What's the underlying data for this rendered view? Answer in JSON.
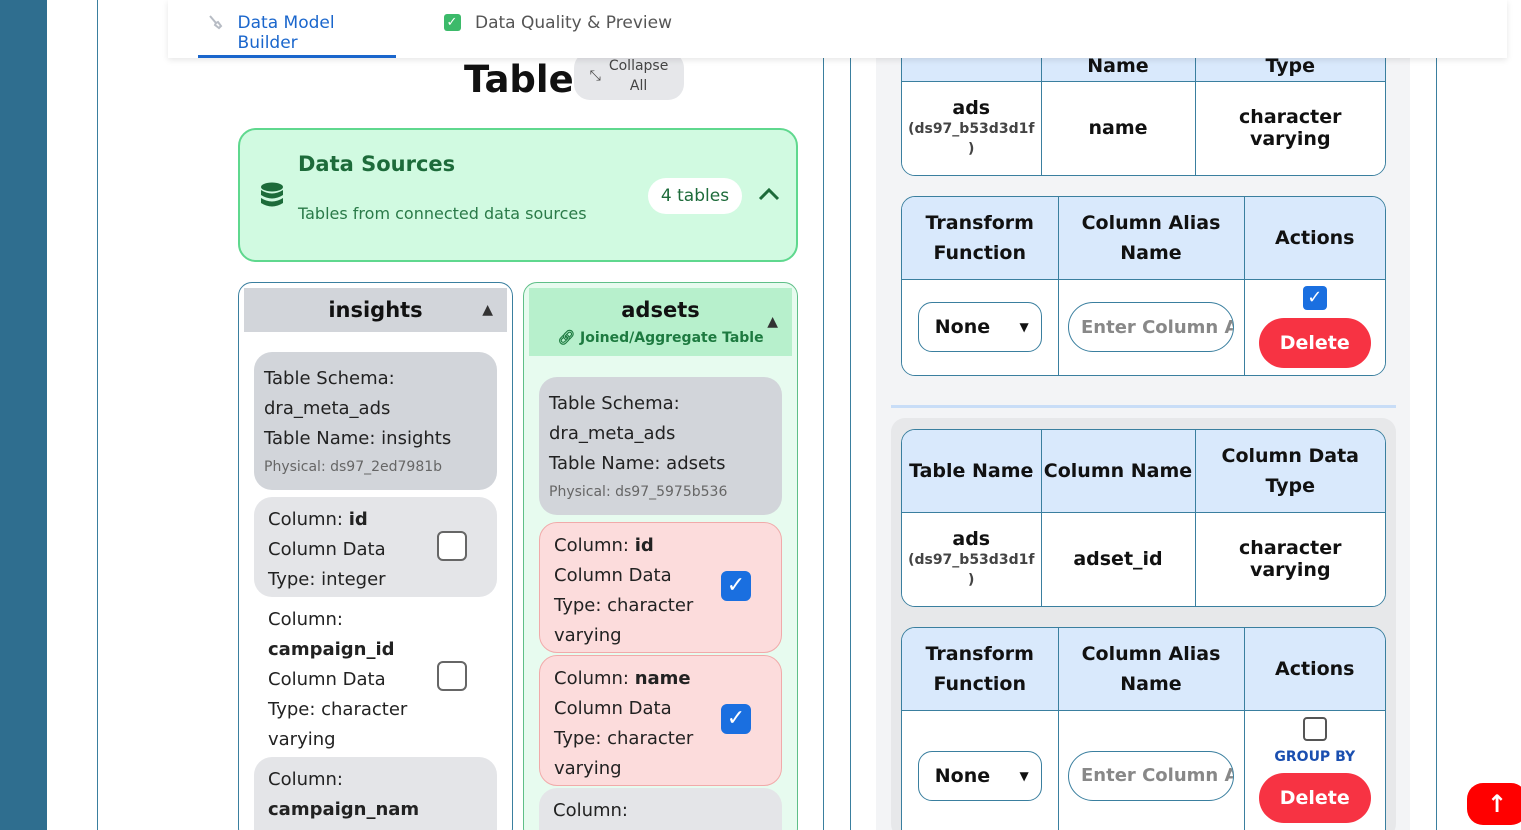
{
  "tabs": [
    {
      "label": "Data Model Builder",
      "icon": "wrench-icon"
    },
    {
      "label": "Data Quality & Preview",
      "icon": "checkbox-icon"
    }
  ],
  "tables_panel": {
    "title": "Tables",
    "collapse_label_line1": "Collapse",
    "collapse_label_line2": "All"
  },
  "data_sources": {
    "title": "Data Sources",
    "subtitle": "Tables from connected data sources",
    "count": "4 tables"
  },
  "insights": {
    "name": "insights",
    "schema_line1": "Table Schema:",
    "schema_line2": "dra_meta_ads",
    "table_name_line": "Table Name: insights",
    "physical": "Physical: ds97_2ed7981b",
    "columns": [
      {
        "prefix": "Column: ",
        "name": "id",
        "type_line1": "Column Data",
        "type_line2": "Type: integer",
        "checked": false
      },
      {
        "prefix": "Column:",
        "name": "campaign_id",
        "type_line1": "Column Data",
        "type_line2": "Type: character",
        "type_line3": "varying",
        "checked": false
      },
      {
        "prefix": "Column:",
        "name": "campaign_nam"
      }
    ]
  },
  "adsets": {
    "name": "adsets",
    "joined_label": "Joined/Aggregate Table",
    "schema_line1": "Table Schema:",
    "schema_line2": "dra_meta_ads",
    "table_name_line": "Table Name: adsets",
    "physical": "Physical: ds97_5975b536",
    "columns": [
      {
        "prefix": "Column: ",
        "name": "id",
        "type_line1": "Column Data",
        "type_line2": "Type: character",
        "type_line3": "varying",
        "checked": true
      },
      {
        "prefix": "Column: ",
        "name": "name",
        "type_line1": "Column Data",
        "type_line2": "Type: character",
        "type_line3": "varying",
        "checked": true
      },
      {
        "prefix": "Column:"
      }
    ]
  },
  "right_panel": {
    "top_table": {
      "partial_headers": [
        "Name",
        "Type"
      ],
      "row": {
        "table": "ads",
        "table_sub1": "(ds97_b53d3d1f",
        "table_sub2": ")",
        "column": "name",
        "data_type": "character varying"
      }
    },
    "top_transform": {
      "headers": [
        "Transform Function",
        "Column Alias Name",
        "Actions"
      ],
      "select_value": "None",
      "alias_placeholder": "Enter Column Alias",
      "checked": true,
      "delete_label": "Delete"
    },
    "second_table": {
      "headers": [
        "Table Name",
        "Column Name",
        "Column Data Type"
      ],
      "row": {
        "table": "ads",
        "table_sub1": "(ds97_b53d3d1f",
        "table_sub2": ")",
        "column": "adset_id",
        "data_type": "character varying"
      }
    },
    "second_transform": {
      "headers": [
        "Transform Function",
        "Column Alias Name",
        "Actions"
      ],
      "select_value": "None",
      "alias_placeholder": "Enter Column Alias",
      "checked": false,
      "group_by_label": "GROUP BY",
      "delete_label": "Delete"
    }
  },
  "colors": {
    "accent": "#1a66cc",
    "success": "#3cba6a",
    "danger": "#f73343",
    "sidebar": "#2f6e8f"
  }
}
